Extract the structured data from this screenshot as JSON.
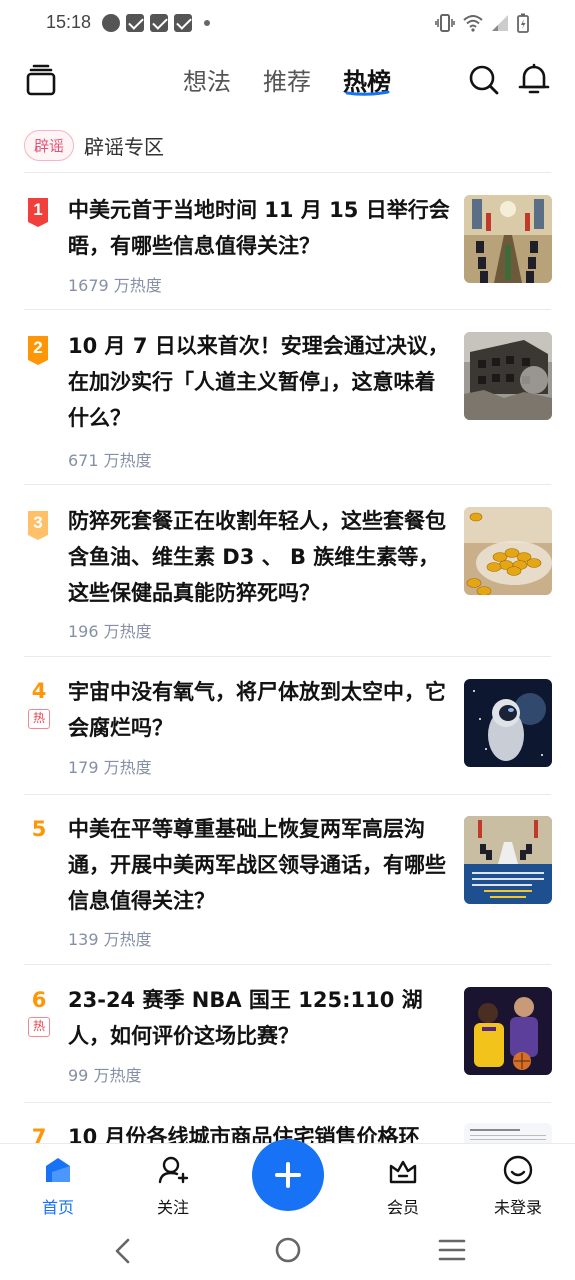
{
  "status_bar": {
    "time": "15:18"
  },
  "header": {
    "tabs": [
      "想法",
      "推荐",
      "热榜"
    ],
    "active_tab": "热榜"
  },
  "rumor": {
    "badge": "辟谣",
    "label": "辟谣专区"
  },
  "hot_list": [
    {
      "rank": "1",
      "title": "中美元首于当地时间 11 月 15 日举行会晤，有哪些信息值得关注？",
      "heat": "1679 万热度",
      "hot": false
    },
    {
      "rank": "2",
      "title": "10 月 7 日以来首次！安理会通过决议，在加沙实行「人道主义暂停」，这意味着什么？",
      "heat": "671 万热度",
      "hot": false
    },
    {
      "rank": "3",
      "title": "防猝死套餐正在收割年轻人，这些套餐包含鱼油、维生素 D3 、 B 族维生素等，这些保健品真能防猝死吗？",
      "heat": "196 万热度",
      "hot": false
    },
    {
      "rank": "4",
      "title": "宇宙中没有氧气，将尸体放到太空中，它会腐烂吗？",
      "heat": "179 万热度",
      "hot": true,
      "hot_label": "热"
    },
    {
      "rank": "5",
      "title": "中美在平等尊重基础上恢复两军高层沟通，开展中美两军战区领导通话，有哪些信息值得关注？",
      "heat": "139 万热度",
      "hot": false
    },
    {
      "rank": "6",
      "title": "23-24 赛季 NBA 国王 125:110 湖人，如何评价这场比赛？",
      "heat": "99 万热度",
      "hot": true,
      "hot_label": "热"
    },
    {
      "rank": "7",
      "title": "10 月份各线城市商品住宅销售价格环",
      "heat": "",
      "hot": false
    }
  ],
  "bottom_nav": {
    "home": "首页",
    "follow": "关注",
    "vip": "会员",
    "profile": "未登录"
  },
  "colors": {
    "accent": "#1772f6",
    "rank1": "#f1403c",
    "rank2": "#ff9607",
    "rank3": "#ffc068",
    "rank_other": "#ff9607",
    "heat_text": "#8590a6"
  }
}
